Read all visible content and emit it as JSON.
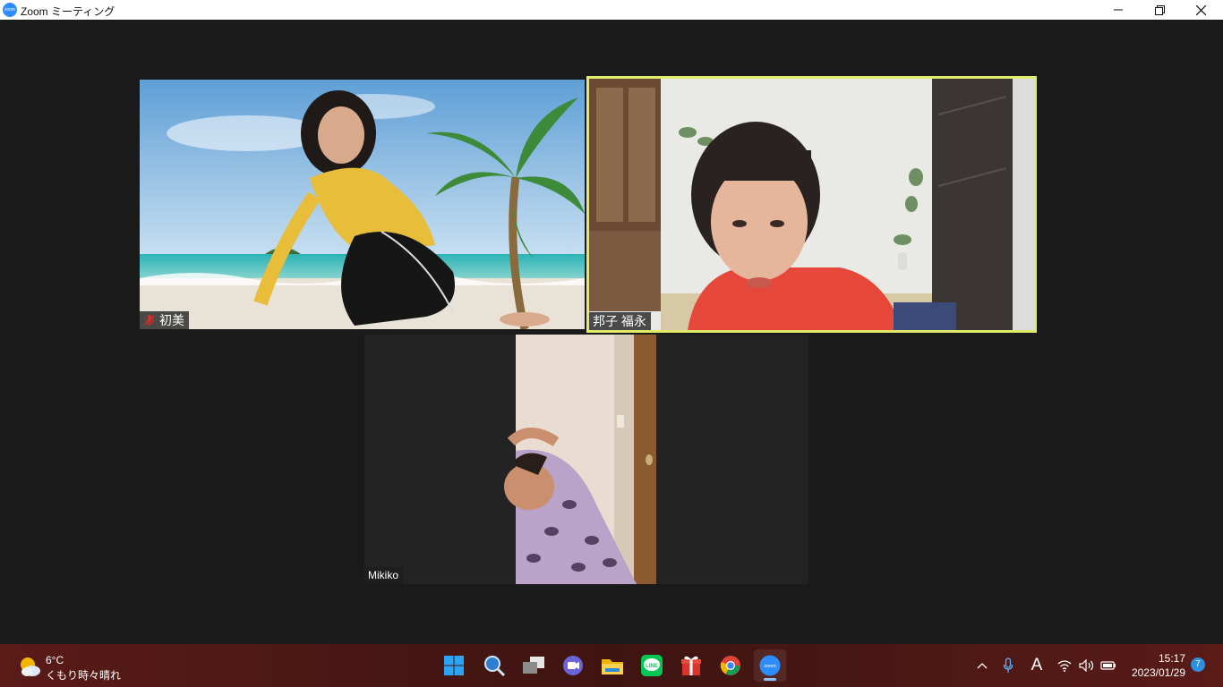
{
  "window": {
    "title": "Zoom ミーティング",
    "logo_text": "zoom"
  },
  "participants": [
    {
      "name": "初美",
      "muted": true
    },
    {
      "name": "邦子 福永",
      "muted": false,
      "active_speaker": true
    },
    {
      "name": "Mikiko",
      "muted": false
    }
  ],
  "taskbar": {
    "weather": {
      "temp": "6°C",
      "desc": "くもり時々晴れ"
    },
    "apps": [
      "start-icon",
      "search-icon",
      "task-view-icon",
      "chat-icon",
      "file-explorer-icon",
      "line-icon",
      "gift-icon",
      "chrome-icon",
      "zoom-icon"
    ],
    "zoom_icon_text": "zoom",
    "line_icon_text": "LINE",
    "tray": {
      "ime": "A",
      "time": "15:17",
      "date": "2023/01/29",
      "notifications": "7"
    }
  },
  "colors": {
    "active_speaker_border": "#e2ea6c",
    "zoom_blue": "#2d8cff",
    "taskbar": "#4a1714"
  }
}
